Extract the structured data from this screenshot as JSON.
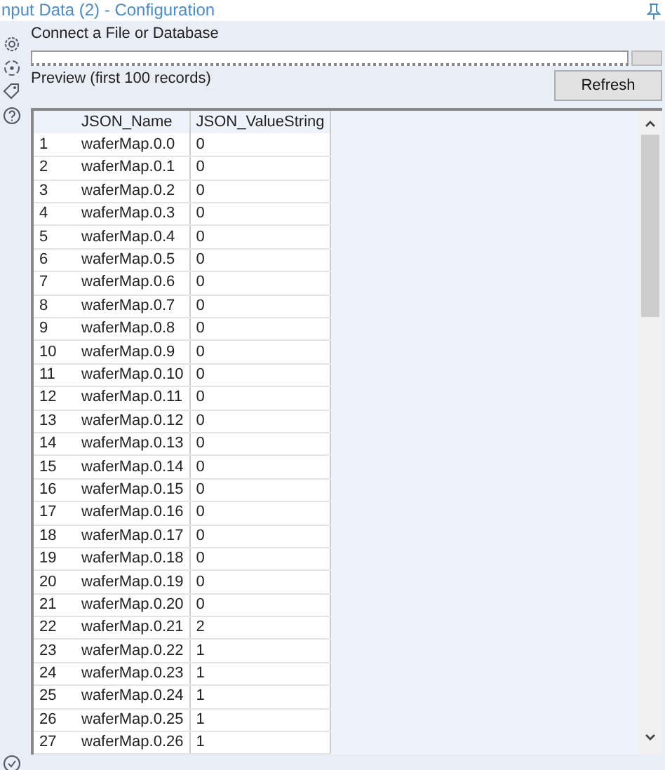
{
  "window": {
    "title": "nput Data (2) - Configuration"
  },
  "connect": {
    "label": "Connect a File or Database"
  },
  "preview": {
    "label": "Preview (first 100 records)",
    "refresh_button": "Refresh"
  },
  "table": {
    "columns": [
      "",
      "JSON_Name",
      "JSON_ValueString"
    ],
    "rows": [
      [
        "1",
        "waferMap.0.0",
        "0"
      ],
      [
        "2",
        "waferMap.0.1",
        "0"
      ],
      [
        "3",
        "waferMap.0.2",
        "0"
      ],
      [
        "4",
        "waferMap.0.3",
        "0"
      ],
      [
        "5",
        "waferMap.0.4",
        "0"
      ],
      [
        "6",
        "waferMap.0.5",
        "0"
      ],
      [
        "7",
        "waferMap.0.6",
        "0"
      ],
      [
        "8",
        "waferMap.0.7",
        "0"
      ],
      [
        "9",
        "waferMap.0.8",
        "0"
      ],
      [
        "10",
        "waferMap.0.9",
        "0"
      ],
      [
        "11",
        "waferMap.0.10",
        "0"
      ],
      [
        "12",
        "waferMap.0.11",
        "0"
      ],
      [
        "13",
        "waferMap.0.12",
        "0"
      ],
      [
        "14",
        "waferMap.0.13",
        "0"
      ],
      [
        "15",
        "waferMap.0.14",
        "0"
      ],
      [
        "16",
        "waferMap.0.15",
        "0"
      ],
      [
        "17",
        "waferMap.0.16",
        "0"
      ],
      [
        "18",
        "waferMap.0.17",
        "0"
      ],
      [
        "19",
        "waferMap.0.18",
        "0"
      ],
      [
        "20",
        "waferMap.0.19",
        "0"
      ],
      [
        "21",
        "waferMap.0.20",
        "0"
      ],
      [
        "22",
        "waferMap.0.21",
        "2"
      ],
      [
        "23",
        "waferMap.0.22",
        "1"
      ],
      [
        "24",
        "waferMap.0.23",
        "1"
      ],
      [
        "25",
        "waferMap.0.24",
        "1"
      ],
      [
        "26",
        "waferMap.0.25",
        "1"
      ],
      [
        "27",
        "waferMap.0.26",
        "1"
      ]
    ]
  }
}
